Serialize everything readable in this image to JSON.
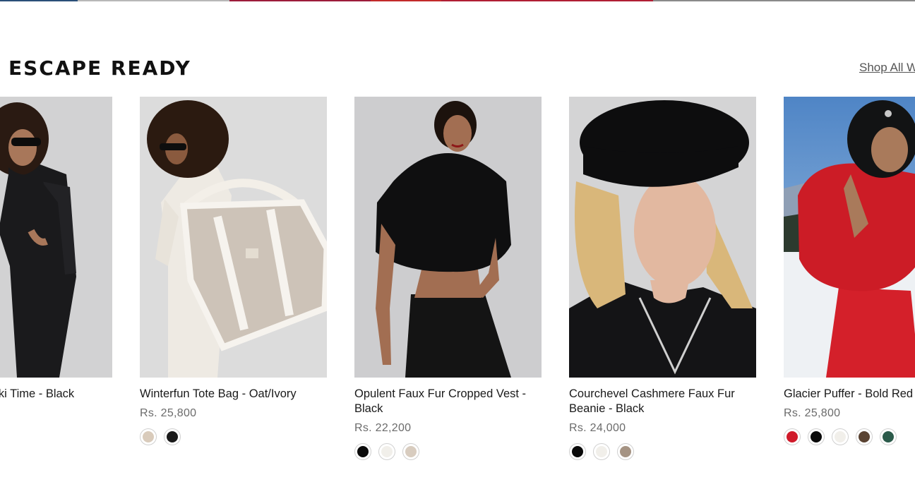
{
  "section": {
    "title": "ESCAPE READY",
    "shop_all_label": "Shop All W"
  },
  "products": [
    {
      "name": "Warm Mesh Ski Time - Black",
      "image": "woman-in-black-ski-suit",
      "swatches": []
    },
    {
      "name": "Winterfun Tote Bag - Oat/Ivory",
      "price": "Rs. 25,800",
      "image": "woman-with-sherpa-tote-bag",
      "swatches": [
        "#d9cbbb",
        "#1a1a1a"
      ]
    },
    {
      "name": "Opulent Faux Fur Cropped Vest - Black",
      "price": "Rs. 22,200",
      "image": "woman-in-black-fur-vest",
      "swatches": [
        "#0a0a0a",
        "#f1efea",
        "#d8ccbf"
      ]
    },
    {
      "name": "Courchevel Cashmere Faux Fur Beanie - Black",
      "price": "Rs. 24,000",
      "image": "woman-in-black-fur-hat",
      "swatches": [
        "#0a0a0a",
        "#f1efea",
        "#a59383"
      ]
    },
    {
      "name": "Glacier Puffer - Bold Red",
      "price": "Rs. 25,800",
      "image": "woman-in-red-puffer",
      "swatches": [
        "#d01a2a",
        "#0a0a0a",
        "#f1efea",
        "#5a4332",
        "#2b5a4a"
      ]
    }
  ]
}
